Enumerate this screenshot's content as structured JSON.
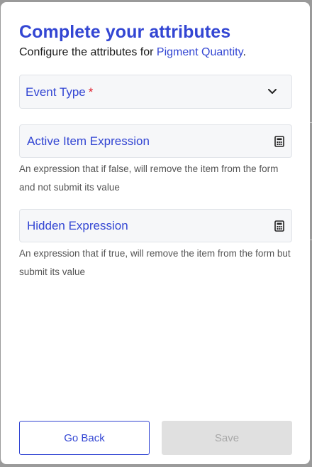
{
  "modal": {
    "title": "Complete your attributes",
    "subtitle_prefix": "Configure the attributes for ",
    "subtitle_link": "Pigment Quantity",
    "subtitle_suffix": "."
  },
  "fields": {
    "event_type": {
      "label": "Event Type",
      "required_marker": "*",
      "icon": "chevron-down-icon"
    },
    "active_item_expression": {
      "label": "Active Item Expression",
      "icon": "calculator-icon",
      "help": "An expression that if false, will remove the item from the form and not submit its value"
    },
    "hidden_expression": {
      "label": "Hidden Expression",
      "icon": "calculator-icon",
      "help": "An expression that if true, will remove the item from the form but submit its value"
    }
  },
  "buttons": {
    "back_label": "Go Back",
    "save_label": "Save",
    "save_disabled": true
  },
  "colors": {
    "accent": "#3346d3",
    "required": "#e0202e",
    "disabled_bg": "#e0e0e0",
    "disabled_text": "#a8a8a8"
  }
}
